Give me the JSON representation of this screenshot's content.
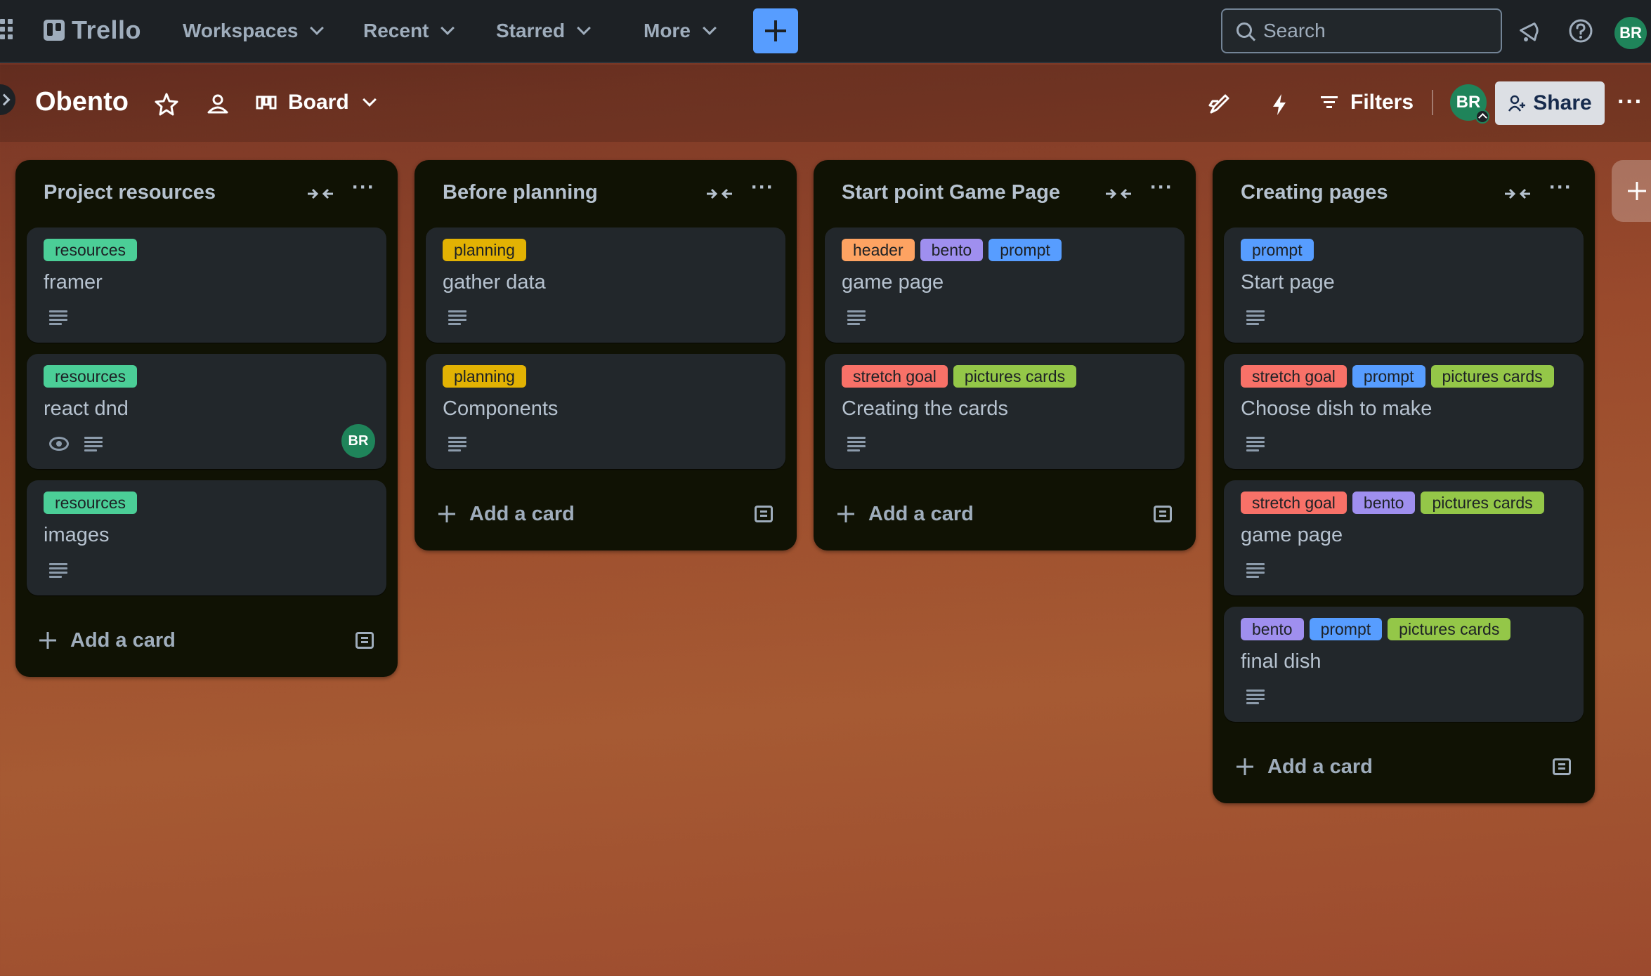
{
  "nav": {
    "logo_text": "Trello",
    "menus": [
      {
        "label": "Workspaces"
      },
      {
        "label": "Recent"
      },
      {
        "label": "Starred"
      },
      {
        "label": "More"
      }
    ],
    "search_placeholder": "Search",
    "user_initials": "BR"
  },
  "board": {
    "title": "Obento",
    "view_label": "Board",
    "filters_label": "Filters",
    "member_initials": "BR",
    "share_label": "Share"
  },
  "label_colors": {
    "resources": "#4bce97",
    "planning": "#e2b203",
    "header": "#fea362",
    "bento": "#9f8fef",
    "prompt": "#579dff",
    "stretch goal": "#f87168",
    "pictures cards": "#94c748"
  },
  "lists": [
    {
      "title": "Project resources",
      "add_card_label": "Add a card",
      "cards": [
        {
          "labels": [
            "resources"
          ],
          "title": "framer",
          "has_description": true,
          "watching": false,
          "member": ""
        },
        {
          "labels": [
            "resources"
          ],
          "title": "react dnd",
          "has_description": true,
          "watching": true,
          "member": "BR"
        },
        {
          "labels": [
            "resources"
          ],
          "title": "images",
          "has_description": true,
          "watching": false,
          "member": ""
        }
      ]
    },
    {
      "title": "Before planning",
      "add_card_label": "Add a card",
      "cards": [
        {
          "labels": [
            "planning"
          ],
          "title": "gather data",
          "has_description": true,
          "watching": false,
          "member": ""
        },
        {
          "labels": [
            "planning"
          ],
          "title": "Components",
          "has_description": true,
          "watching": false,
          "member": ""
        }
      ]
    },
    {
      "title": "Start point Game Page",
      "add_card_label": "Add a card",
      "cards": [
        {
          "labels": [
            "header",
            "bento",
            "prompt"
          ],
          "title": "game page",
          "has_description": true,
          "watching": false,
          "member": ""
        },
        {
          "labels": [
            "stretch goal",
            "pictures cards"
          ],
          "title": "Creating the cards",
          "has_description": true,
          "watching": false,
          "member": ""
        }
      ]
    },
    {
      "title": "Creating pages",
      "add_card_label": "Add a card",
      "cards": [
        {
          "labels": [
            "prompt"
          ],
          "title": "Start page",
          "has_description": true,
          "watching": false,
          "member": ""
        },
        {
          "labels": [
            "stretch goal",
            "prompt",
            "pictures cards"
          ],
          "title": "Choose dish to make",
          "has_description": true,
          "watching": false,
          "member": ""
        },
        {
          "labels": [
            "stretch goal",
            "bento",
            "pictures cards"
          ],
          "title": "game page",
          "has_description": true,
          "watching": false,
          "member": ""
        },
        {
          "labels": [
            "bento",
            "prompt",
            "pictures cards"
          ],
          "title": "final dish",
          "has_description": true,
          "watching": false,
          "member": ""
        }
      ]
    }
  ]
}
